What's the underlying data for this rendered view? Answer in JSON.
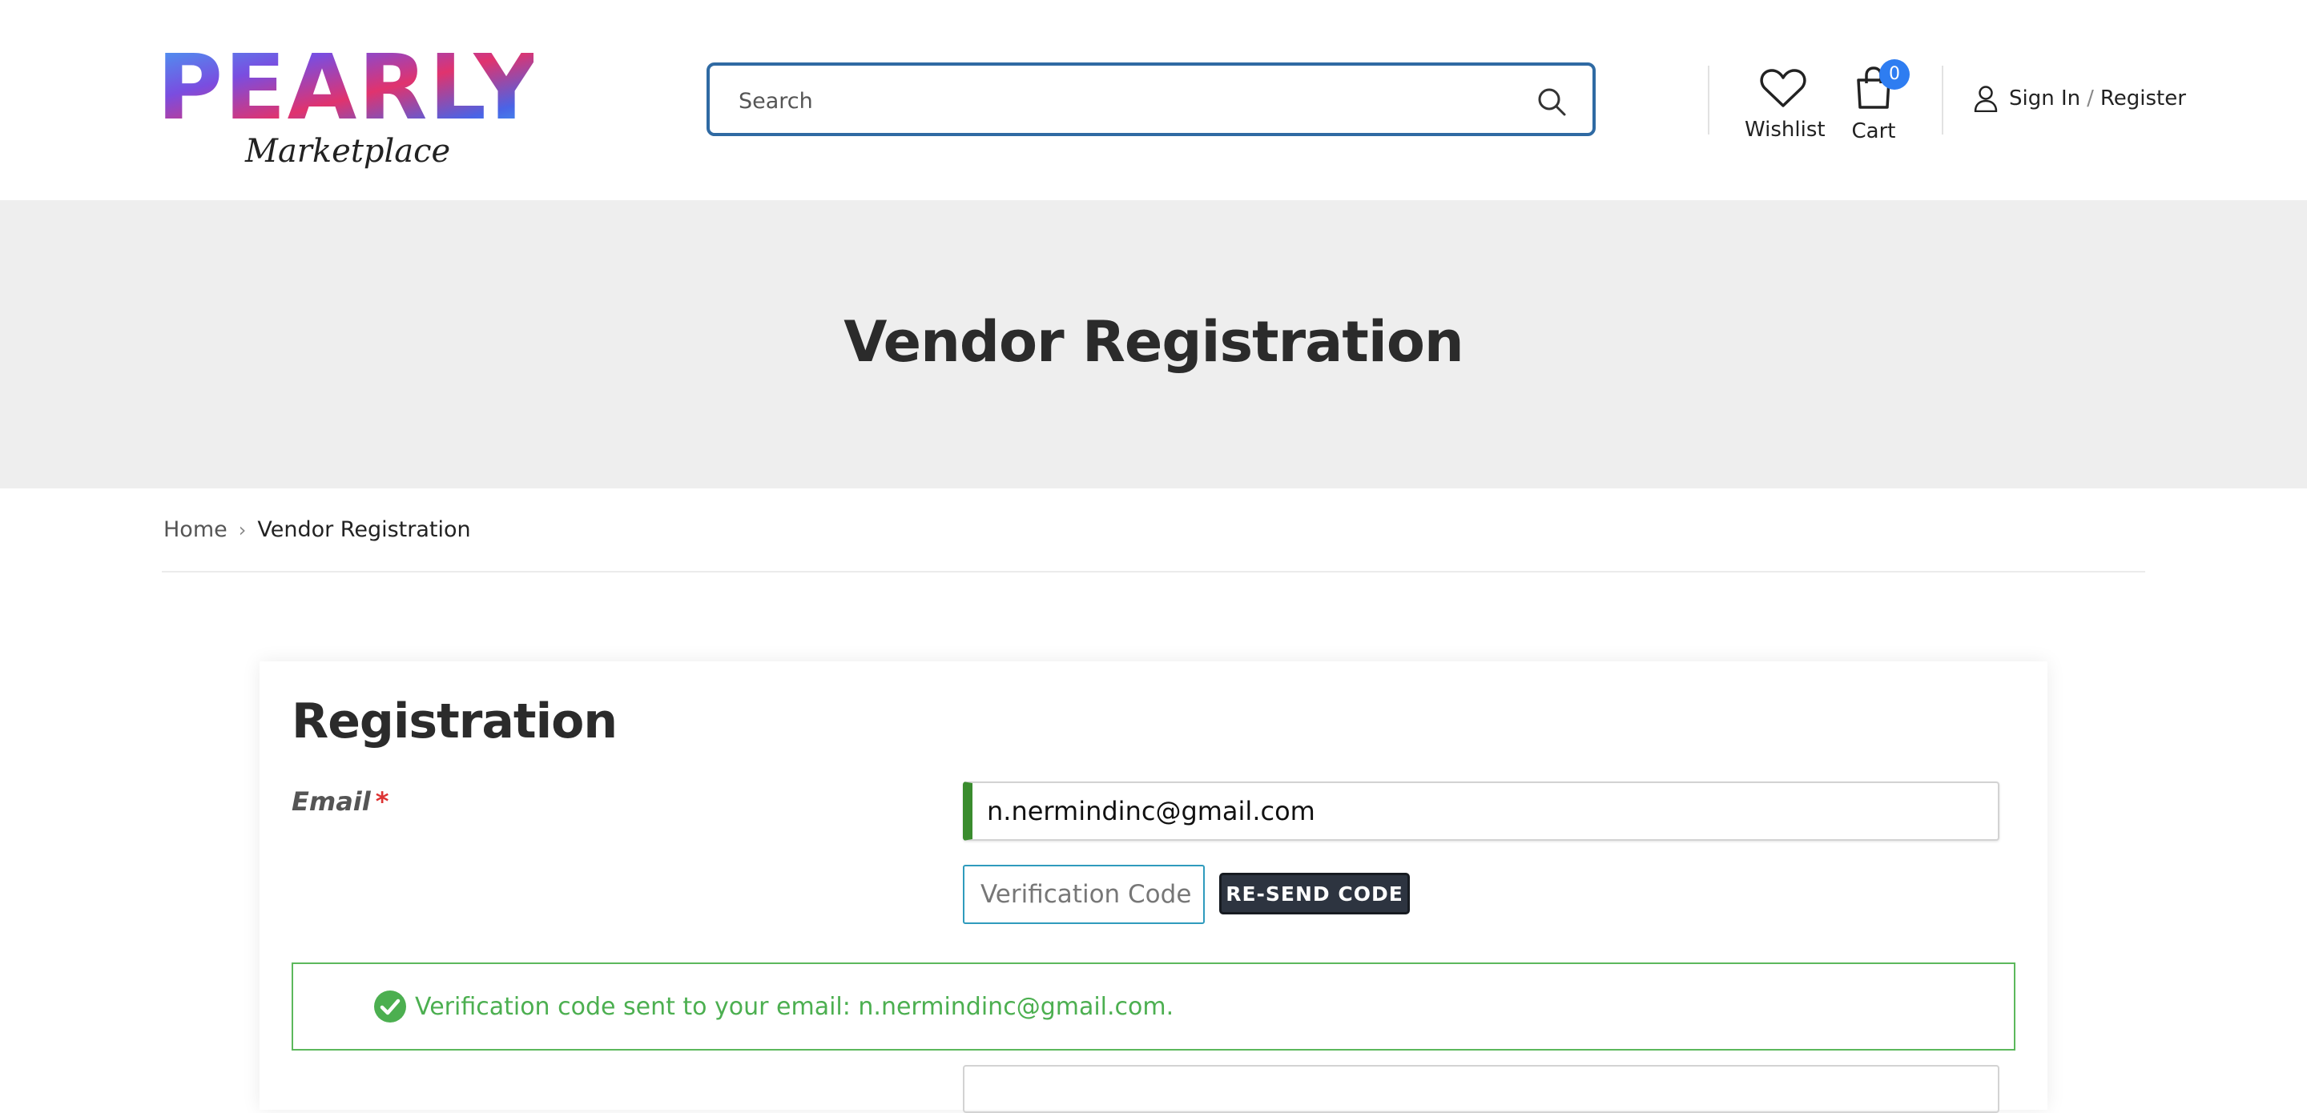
{
  "header": {
    "logo_text": "PEARLY",
    "logo_tagline": "Marketplace",
    "search_placeholder": "Search",
    "wishlist_label": "Wishlist",
    "cart_label": "Cart",
    "cart_count": "0",
    "signin_label": "Sign In",
    "signin_separator": "/",
    "register_label": "Register"
  },
  "banner": {
    "title": "Vendor Registration"
  },
  "breadcrumb": {
    "home": "Home",
    "current": "Vendor Registration"
  },
  "form": {
    "heading": "Registration",
    "email_label": "Email",
    "required_mark": "*",
    "email_value": "n.nermindinc@gmail.com",
    "verification_placeholder": "Verification Code",
    "resend_button": "RE-SEND CODE",
    "success_message": "Verification code sent to your email: n.nermindinc@gmail.com."
  },
  "colors": {
    "search_border": "#2f6aa3",
    "cart_badge": "#2e7df1",
    "email_valid_bar": "#3a8c2e",
    "success_text": "#4caf50",
    "resend_bg": "#2d3440"
  }
}
